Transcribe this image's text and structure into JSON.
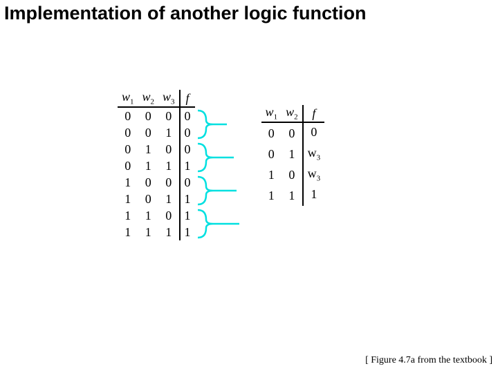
{
  "title": "Implementation of another logic function",
  "left_table": {
    "headers": {
      "c0": "w",
      "s0": "1",
      "c1": "w",
      "s1": "2",
      "c2": "w",
      "s2": "3",
      "f": "f"
    },
    "rows": [
      {
        "c0": "0",
        "c1": "0",
        "c2": "0",
        "f": "0"
      },
      {
        "c0": "0",
        "c1": "0",
        "c2": "1",
        "f": "0"
      },
      {
        "c0": "0",
        "c1": "1",
        "c2": "0",
        "f": "0"
      },
      {
        "c0": "0",
        "c1": "1",
        "c2": "1",
        "f": "1"
      },
      {
        "c0": "1",
        "c1": "0",
        "c2": "0",
        "f": "0"
      },
      {
        "c0": "1",
        "c1": "0",
        "c2": "1",
        "f": "1"
      },
      {
        "c0": "1",
        "c1": "1",
        "c2": "0",
        "f": "1"
      },
      {
        "c0": "1",
        "c1": "1",
        "c2": "1",
        "f": "1"
      }
    ]
  },
  "right_table": {
    "headers": {
      "c0": "w",
      "s0": "1",
      "c1": "w",
      "s1": "2",
      "f": "f"
    },
    "rows": [
      {
        "c0": "0",
        "c1": "0",
        "f": "0",
        "fsub": ""
      },
      {
        "c0": "0",
        "c1": "1",
        "f": "w",
        "fsub": "3"
      },
      {
        "c0": "1",
        "c1": "0",
        "f": "w",
        "fsub": "3"
      },
      {
        "c0": "1",
        "c1": "1",
        "f": "1",
        "fsub": ""
      }
    ]
  },
  "footer": "[ Figure 4.7a from the textbook ]",
  "chart_data": {
    "type": "table",
    "description": "Truth table for Boolean function f(w1,w2,w3) and its decomposition by w1,w2 with output expressed in terms of w3.",
    "full_truth_table": {
      "inputs": [
        "w1",
        "w2",
        "w3"
      ],
      "output": "f",
      "rows": [
        [
          0,
          0,
          0,
          0
        ],
        [
          0,
          0,
          1,
          0
        ],
        [
          0,
          1,
          0,
          0
        ],
        [
          0,
          1,
          1,
          1
        ],
        [
          1,
          0,
          0,
          0
        ],
        [
          1,
          0,
          1,
          1
        ],
        [
          1,
          1,
          0,
          1
        ],
        [
          1,
          1,
          1,
          1
        ]
      ]
    },
    "reduced_table": {
      "inputs": [
        "w1",
        "w2"
      ],
      "output": "f",
      "rows": [
        {
          "w1": 0,
          "w2": 0,
          "f": "0"
        },
        {
          "w1": 0,
          "w2": 1,
          "f": "w3"
        },
        {
          "w1": 1,
          "w2": 0,
          "f": "w3"
        },
        {
          "w1": 1,
          "w2": 1,
          "f": "1"
        }
      ]
    },
    "grouping": "Each pair of full-table rows sharing (w1,w2) is bracketed and mapped to one reduced-table row.",
    "source_label": "Figure 4.7a"
  }
}
